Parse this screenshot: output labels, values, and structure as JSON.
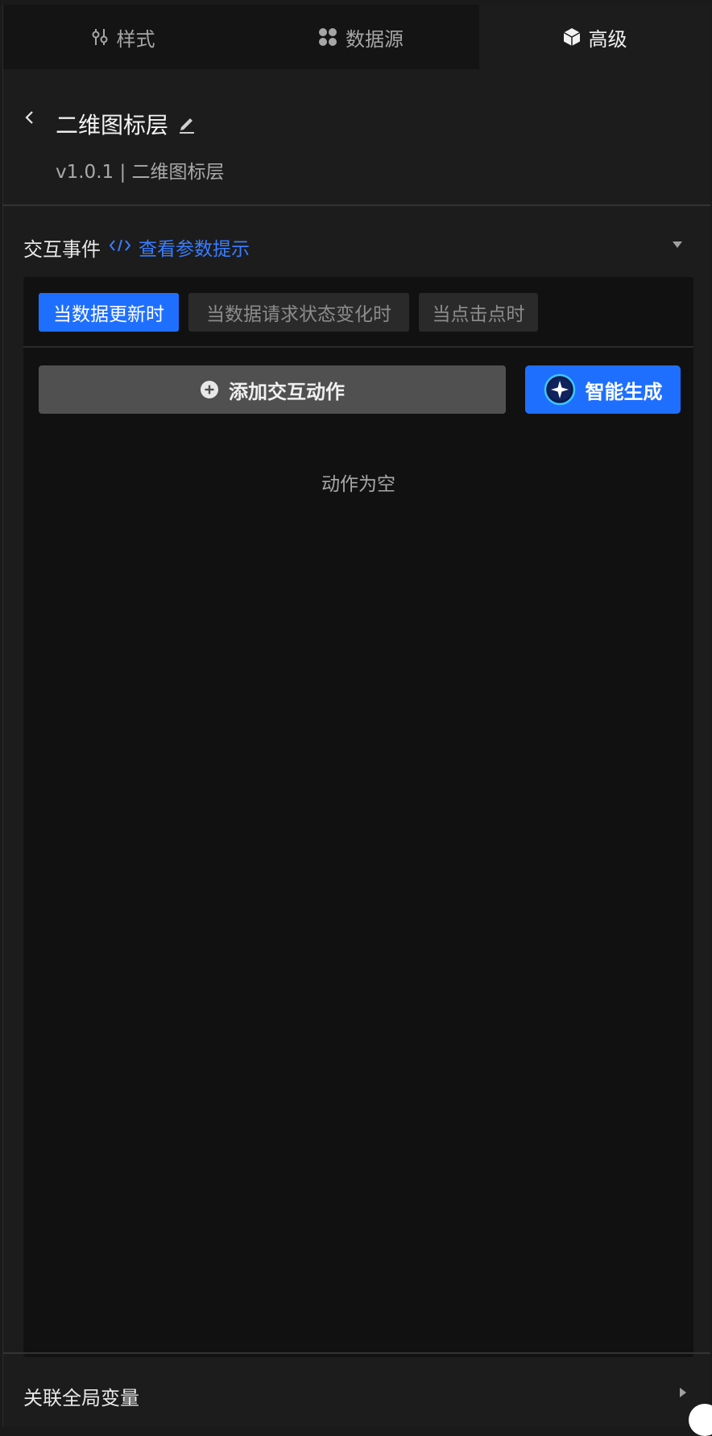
{
  "tabs": {
    "style": "样式",
    "data": "数据源",
    "advanced": "高级"
  },
  "header": {
    "title": "二维图标层",
    "subtitle": "v1.0.1 | 二维图标层"
  },
  "interaction": {
    "section_title": "交互事件",
    "params_link": "查看参数提示",
    "event_tabs": [
      "当数据更新时",
      "当数据请求状态变化时",
      "当点击点时"
    ],
    "add_action": "添加交互动作",
    "ai_generate": "智能生成",
    "empty": "动作为空"
  },
  "footer": {
    "global_var": "关联全局变量"
  },
  "colors": {
    "accent": "#1f6fff",
    "link": "#3a7dff"
  },
  "icons": [
    "sliders-icon",
    "grid-dots-icon",
    "cube-icon",
    "chevron-left-icon",
    "pencil-icon",
    "code-icon",
    "caret-down-icon",
    "plus-circle-icon",
    "sparkle-icon",
    "caret-right-icon"
  ]
}
